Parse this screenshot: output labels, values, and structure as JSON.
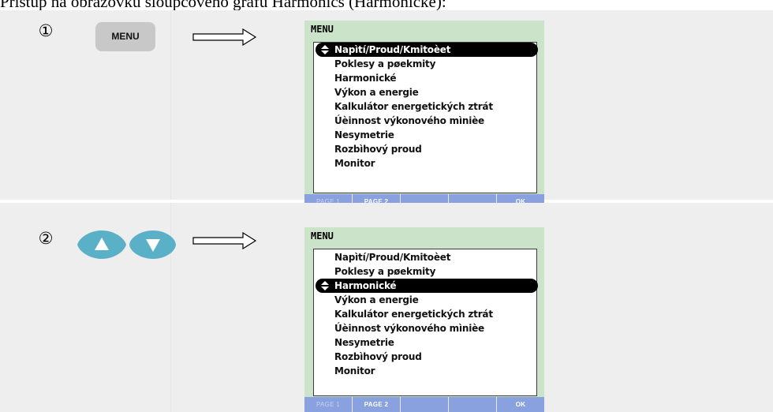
{
  "heading": "Přístup na obrazovku sloupcového grafu Harmonics (Harmonické):",
  "steps": [
    {
      "number": "①",
      "key_label": "MENU",
      "screen": {
        "title": "MENU",
        "items": [
          "Napìtí/Proud/Kmitoèet",
          "Poklesy a pøekmity",
          "Harmonické",
          "Výkon a energie",
          "Kalkulátor energetických ztrát",
          "Úèinnost výkonového mìnièe",
          "Nesymetrie",
          "Rozbìhový proud",
          "Monitor"
        ],
        "selected_item": "Napìtí/Proud/Kmitoèet",
        "softkeys": [
          "PAGE 1",
          "PAGE 2",
          "",
          "",
          "OK"
        ]
      }
    },
    {
      "number": "②",
      "keys": [
        "up-arrow-icon",
        "down-arrow-icon"
      ],
      "screen": {
        "title": "MENU",
        "items": [
          "Napìtí/Proud/Kmitoèet",
          "Poklesy a pøekmity",
          "Harmonické",
          "Výkon a energie",
          "Kalkulátor energetických ztrát",
          "Úèinnost výkonového mìnièe",
          "Nesymetrie",
          "Rozbìhový proud",
          "Monitor"
        ],
        "selected_item": "Harmonické",
        "softkeys": [
          "PAGE 1",
          "PAGE 2",
          "",
          "",
          "OK"
        ]
      }
    }
  ],
  "icons": {
    "arrow": "right-arrow-icon",
    "selection": "up-down-arrows-icon"
  },
  "colors": {
    "panel_bg": "#eeeeee",
    "screen_bg": "#cbe4c9",
    "softkey_bar": "#8aa1df",
    "arrow_key": "#5ab0c6",
    "menu_key": "#c8c8c8"
  }
}
